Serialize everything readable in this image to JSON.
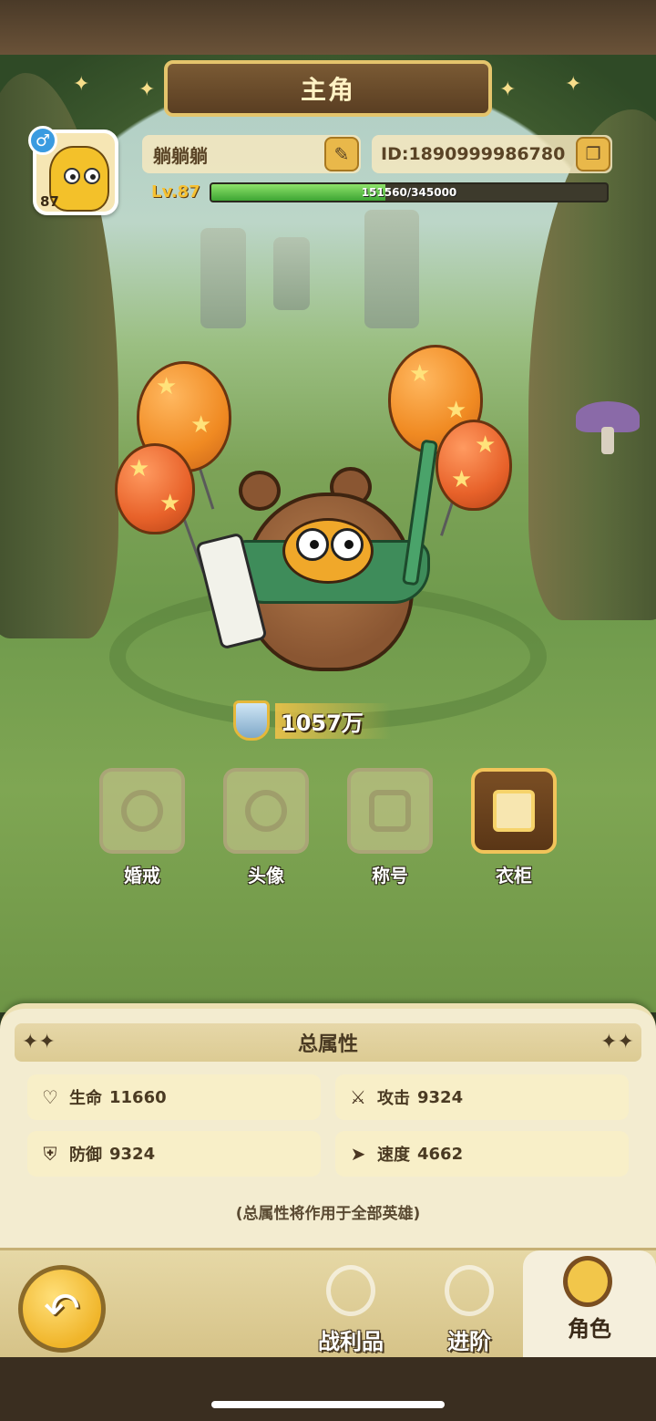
{
  "header": {
    "title": "主角"
  },
  "player": {
    "gender_symbol": "♂",
    "avatar_level": "87",
    "name": "躺躺躺",
    "id_text": "ID:1890999986780",
    "level_label": "Lv.87",
    "exp_text": "151560/345000",
    "exp_progress": 0.4393,
    "edit_icon": "✎",
    "copy_icon": "❐"
  },
  "character": {
    "power": "1057万"
  },
  "slots": [
    {
      "label": "婚戒",
      "state": "locked"
    },
    {
      "label": "头像",
      "state": "locked"
    },
    {
      "label": "称号",
      "state": "locked"
    },
    {
      "label": "衣柜",
      "state": "active"
    }
  ],
  "attributes": {
    "title": "总属性",
    "stats": [
      {
        "name": "生命",
        "value": "11660",
        "icon": "heart-icon",
        "glyph": "♡"
      },
      {
        "name": "攻击",
        "value": "9324",
        "icon": "attack-icon",
        "glyph": "⚔"
      },
      {
        "name": "防御",
        "value": "9324",
        "icon": "shield-icon",
        "glyph": "⛨"
      },
      {
        "name": "速度",
        "value": "4662",
        "icon": "boot-icon",
        "glyph": "➤"
      }
    ],
    "note": "(总属性将作用于全部英雄)"
  },
  "nav": {
    "back_glyph": "↶",
    "tabs": [
      {
        "label": "战利品",
        "active": false
      },
      {
        "label": "进阶",
        "active": false
      },
      {
        "label": "角色",
        "active": true
      }
    ]
  },
  "colors": {
    "accent_gold": "#f1c45a",
    "exp_green": "#3da533",
    "panel_bg": "#f3ecd0"
  }
}
